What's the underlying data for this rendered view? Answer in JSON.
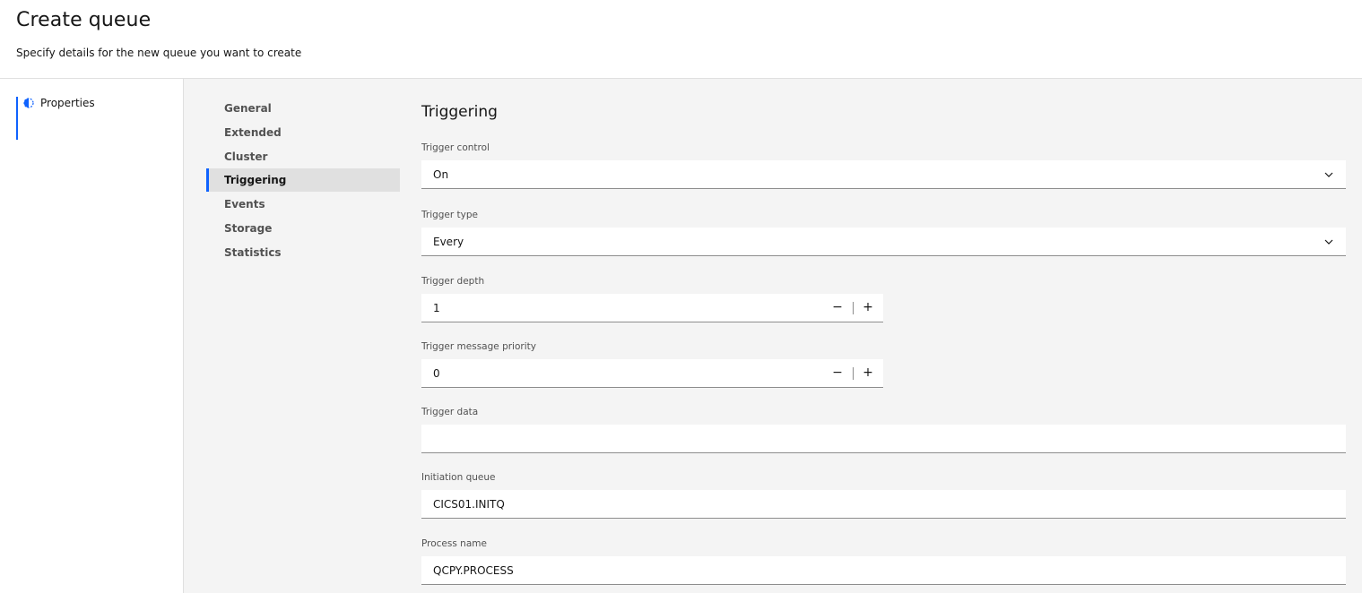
{
  "header": {
    "title": "Create queue",
    "subtitle": "Specify details for the new queue you want to create"
  },
  "progress": {
    "steps": [
      {
        "label": "Properties",
        "icon": "incomplete-circle-icon",
        "state": "current"
      }
    ]
  },
  "section_nav": {
    "items": [
      {
        "label": "General"
      },
      {
        "label": "Extended"
      },
      {
        "label": "Cluster"
      },
      {
        "label": "Triggering",
        "active": true
      },
      {
        "label": "Events"
      },
      {
        "label": "Storage"
      },
      {
        "label": "Statistics"
      }
    ]
  },
  "form": {
    "title": "Triggering",
    "trigger_control": {
      "label": "Trigger control",
      "value": "On"
    },
    "trigger_type": {
      "label": "Trigger type",
      "value": "Every"
    },
    "trigger_depth": {
      "label": "Trigger depth",
      "value": "1",
      "decrement": "−",
      "increment": "+"
    },
    "trigger_message_priority": {
      "label": "Trigger message priority",
      "value": "0",
      "decrement": "−",
      "increment": "+"
    },
    "trigger_data": {
      "label": "Trigger data",
      "value": ""
    },
    "initiation_queue": {
      "label": "Initiation queue",
      "value": "CICS01.INITQ"
    },
    "process_name": {
      "label": "Process name",
      "value": "QCPY.PROCESS"
    }
  },
  "colors": {
    "accent": "#0f62fe",
    "panel_background": "#f4f4f4",
    "field_background": "#ffffff",
    "text_primary": "#161616",
    "text_secondary": "#525252"
  }
}
